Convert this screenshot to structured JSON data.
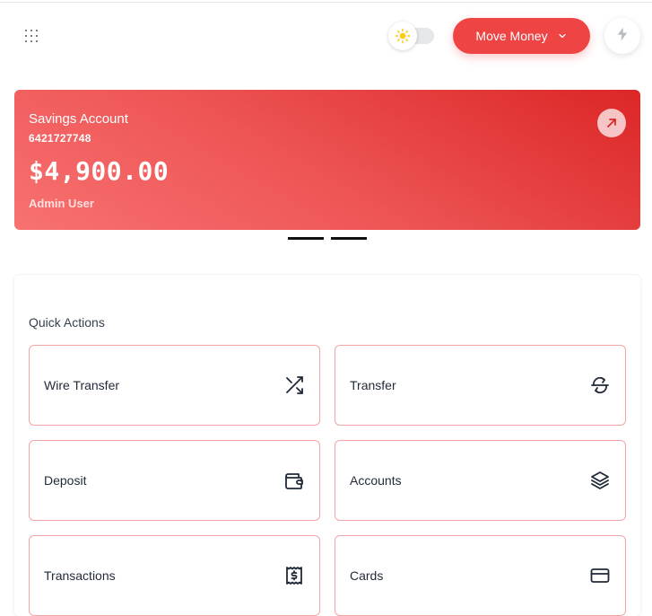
{
  "header": {
    "move_money_label": "Move Money"
  },
  "account_card": {
    "name": "Savings Account",
    "number": "6421727748",
    "balance": "$4,900.00",
    "owner": "Admin User"
  },
  "quick_actions": {
    "title": "Quick Actions",
    "items": [
      {
        "label": "Wire Transfer",
        "icon": "shuffle-icon"
      },
      {
        "label": "Transfer",
        "icon": "arrows-exchange-icon"
      },
      {
        "label": "Deposit",
        "icon": "wallet-icon"
      },
      {
        "label": "Accounts",
        "icon": "layers-icon"
      },
      {
        "label": "Transactions",
        "icon": "receipt-dollar-icon"
      },
      {
        "label": "Cards",
        "icon": "credit-card-icon"
      }
    ]
  },
  "colors": {
    "accent": "#ef4444",
    "card_gradient_start": "#f87171",
    "card_gradient_end": "#dc2626",
    "tile_border": "#f4a4a4"
  }
}
